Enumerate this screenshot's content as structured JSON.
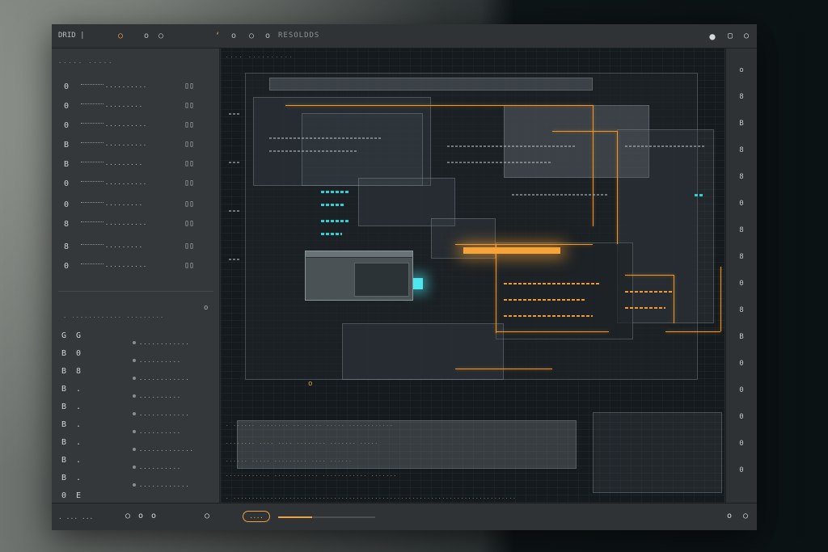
{
  "titlebar": {
    "title": "DRID |",
    "document": "RESOLDDS",
    "icons": [
      "record-icon",
      "circle-icon",
      "circle-icon",
      "marker-icon",
      "circle-icon",
      "circle-icon",
      "circle-icon"
    ]
  },
  "left_panel": {
    "header": "..... .....",
    "rows": [
      {
        "icon": "0",
        "value": "..........",
        "right": "▯▯"
      },
      {
        "icon": "0",
        "value": ".........",
        "right": "▯▯"
      },
      {
        "icon": "0",
        "value": "..........",
        "right": "▯▯"
      },
      {
        "icon": "B",
        "value": "..........",
        "right": "▯▯"
      },
      {
        "icon": "B",
        "value": ".........",
        "right": "▯▯"
      },
      {
        "icon": "0",
        "value": "..........",
        "right": "▯▯"
      },
      {
        "icon": "0",
        "value": ".........",
        "right": "▯▯"
      },
      {
        "icon": "8",
        "value": "..........",
        "right": "▯▯"
      },
      {
        "icon": "8",
        "value": ".........",
        "right": "▯▯"
      },
      {
        "icon": "0",
        "value": "..........",
        "right": "▯▯"
      }
    ],
    "section_label": ". ............ .........",
    "tools": [
      [
        "G",
        "G"
      ],
      [
        "B",
        "0"
      ],
      [
        "B",
        "8"
      ],
      [
        "B",
        "."
      ],
      [
        "B",
        "."
      ],
      [
        "B",
        "."
      ],
      [
        "B",
        "."
      ],
      [
        "B",
        "."
      ],
      [
        "B",
        "."
      ],
      [
        "0",
        "E"
      ]
    ],
    "layers": [
      "............",
      "..........",
      "............",
      "..........",
      "............",
      "..........",
      ".............",
      "..........",
      "............"
    ]
  },
  "canvas": {
    "top_label": "....  ..........",
    "footer_lines": [
      ". ...... ........ .. ..... ..... ............",
      "........ .... .... ........ ....... .....",
      "...... ..... ......... .... ......",
      "............ ............ ............ .......",
      ". ............................................................................"
    ]
  },
  "right_rail": {
    "icons": [
      "o",
      "8",
      "B",
      "8",
      "8",
      "0",
      "8",
      "8",
      "0",
      "8",
      "B",
      "0",
      "0",
      "0",
      "0",
      "0"
    ]
  },
  "statusbar": {
    "left_text": ". ... ...",
    "icons": [
      "circle-icon",
      "circle-icon",
      "circle-icon",
      "circle-icon"
    ],
    "zoom_label": "....",
    "zoom_value": 0.35,
    "right_icons": [
      "circle-icon",
      "circle-icon"
    ]
  },
  "colors": {
    "accent_orange": "#f2962a",
    "accent_cyan": "#2ed0d6",
    "panel": "#34383a",
    "canvas": "#141a1d"
  }
}
